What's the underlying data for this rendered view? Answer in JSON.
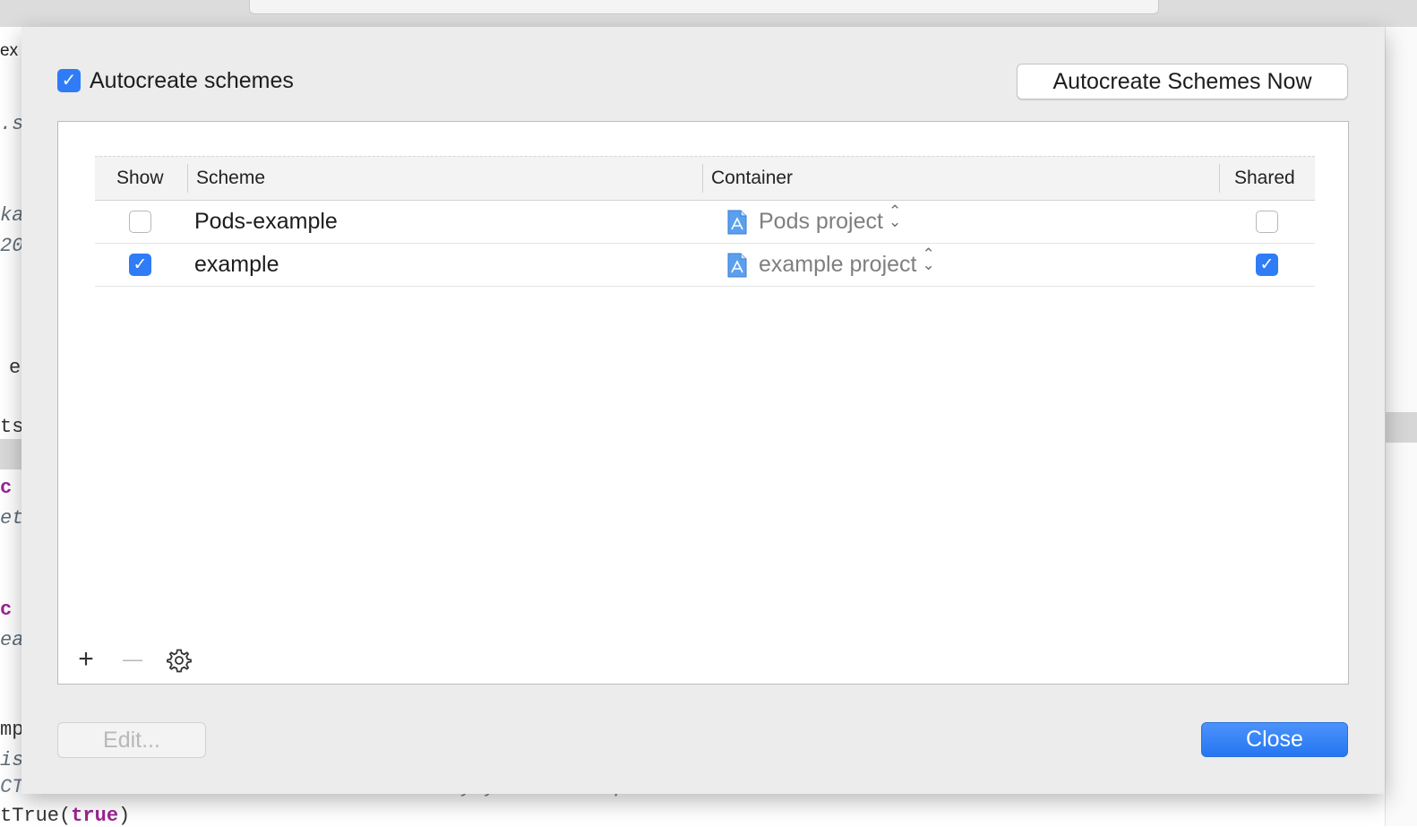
{
  "background_editor": {
    "tab_fragment": "ex",
    "code_fragments": [
      ".s",
      "ka",
      "20",
      "e",
      "ts",
      "c",
      "et",
      "c",
      "ea",
      "mp",
      "is"
    ],
    "bottom_line_1": "CTAssert and related functions to verify your tests produce the correct results.",
    "bottom_line_2_prefix": "tTrue(",
    "bottom_line_2_keyword": "true",
    "bottom_line_2_suffix": ")"
  },
  "sheet": {
    "autocreate_label": "Autocreate schemes",
    "autocreate_checked": true,
    "autocreate_now_button": "Autocreate Schemes Now",
    "table": {
      "columns": [
        "Show",
        "Scheme",
        "Container",
        "Shared"
      ],
      "rows": [
        {
          "show": false,
          "scheme": "Pods-example",
          "container": "Pods project",
          "shared": false
        },
        {
          "show": true,
          "scheme": "example",
          "container": "example project",
          "shared": true
        }
      ]
    },
    "toolbar": {
      "add": "+",
      "remove": "—",
      "settings": "gear"
    },
    "edit_button": "Edit...",
    "close_button": "Close"
  },
  "colors": {
    "accent": "#2f7cf6",
    "sheet_bg": "#ececec"
  }
}
